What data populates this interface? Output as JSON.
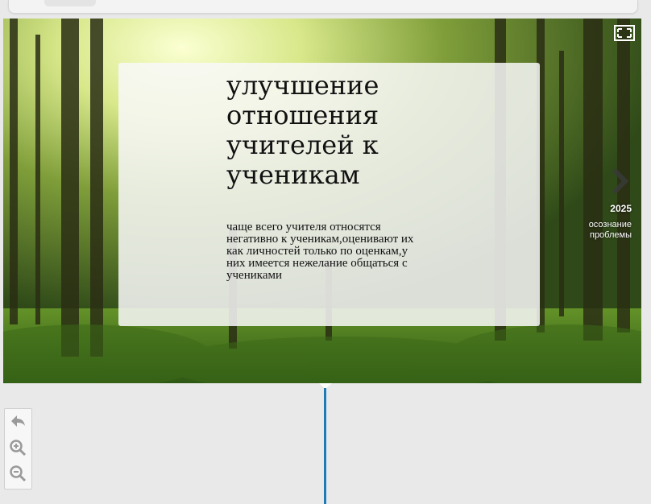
{
  "colors": {
    "timeline_accent": "#1f7bb6",
    "card_background": "#f8f8f8",
    "page_background": "#e9e9e9"
  },
  "event": {
    "title": "улучшение отношения учителей к ученикам",
    "description": "чаще всего учителя относятся негативно к ученикам,оценивают их как личностей только по оценкам,у них имеется нежелание общаться с учениками"
  },
  "next_event": {
    "year": "2025",
    "label": "осознание проблемы"
  },
  "icons": {
    "fullscreen": "fullscreen-icon",
    "next": "chevron-right-icon",
    "back": "back-arrow-icon",
    "zoom_in": "zoom-in-icon",
    "zoom_out": "zoom-out-icon"
  }
}
